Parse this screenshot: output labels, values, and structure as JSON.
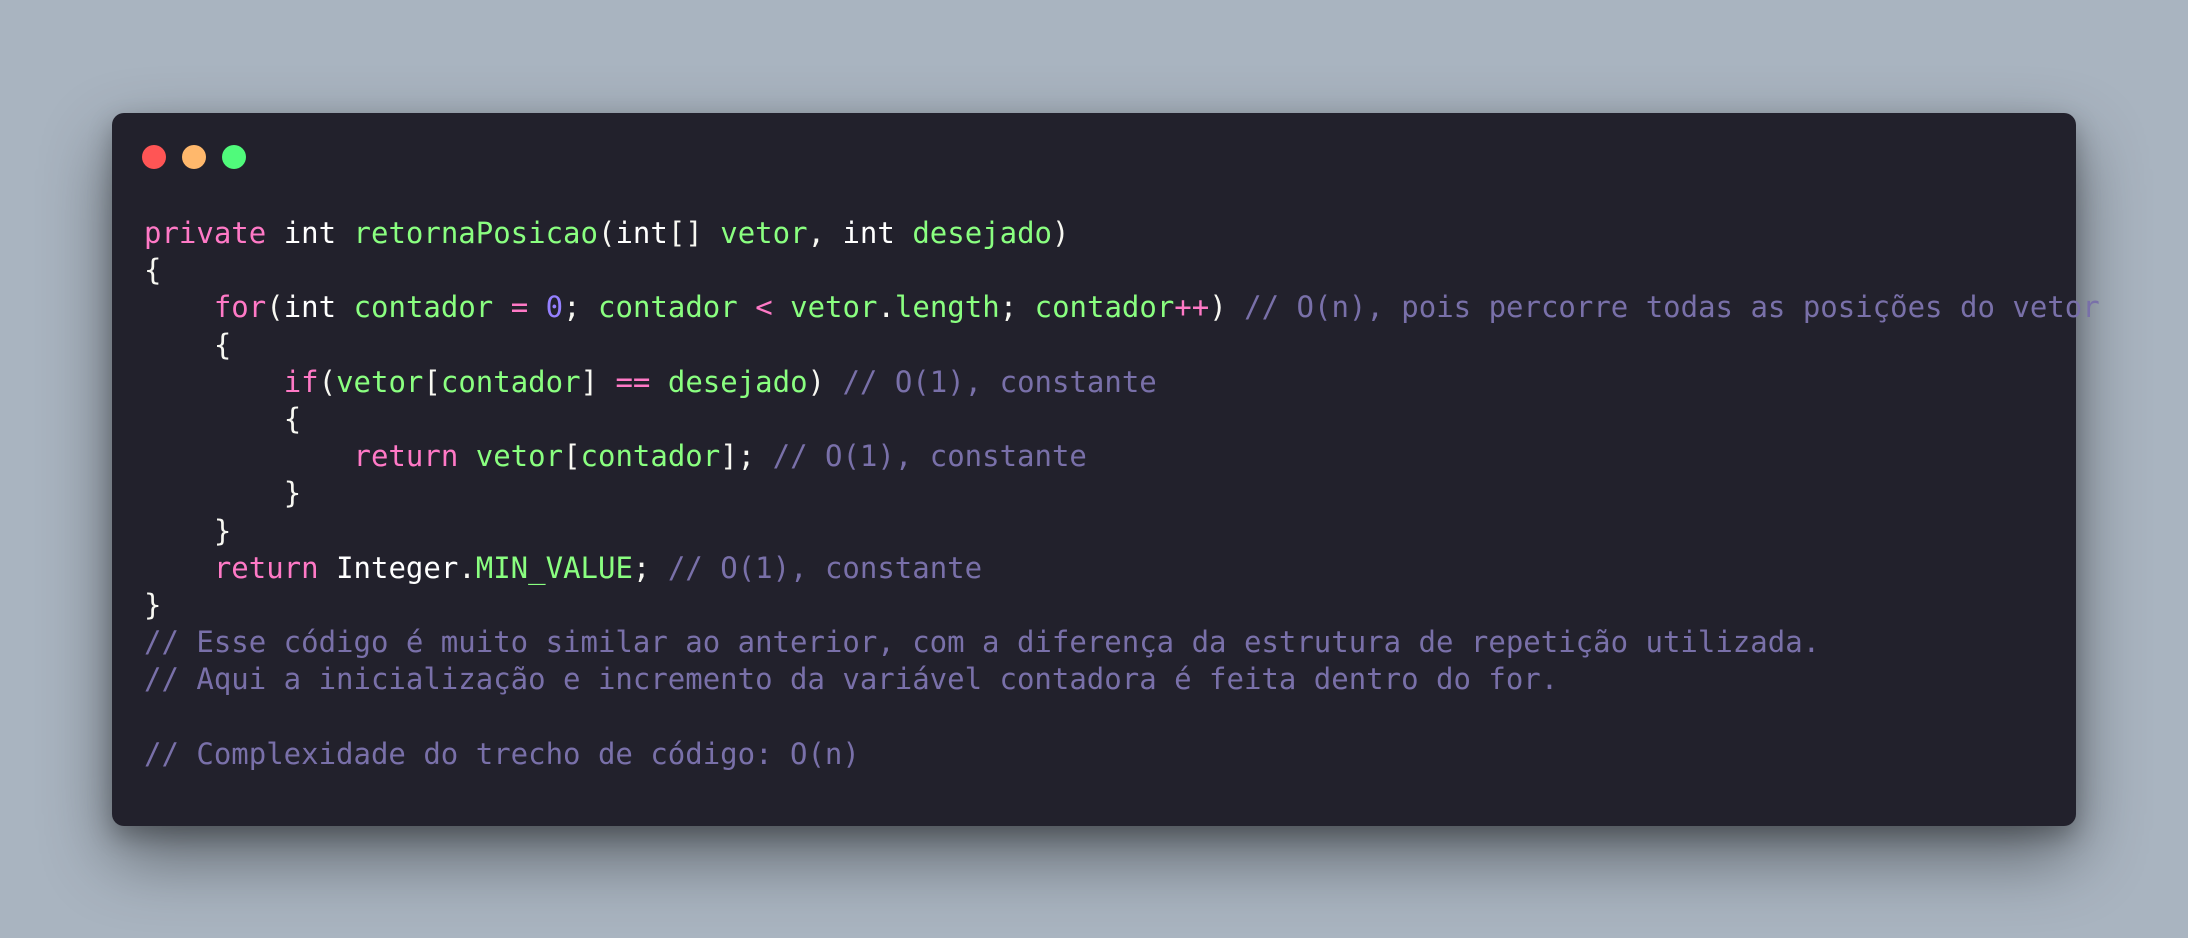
{
  "window": {
    "controls": [
      {
        "name": "close-button",
        "color": "#ff5555"
      },
      {
        "name": "minimize-button",
        "color": "#ffb86c"
      },
      {
        "name": "maximize-button",
        "color": "#50fa7b"
      }
    ]
  },
  "code_lines": [
    [
      {
        "t": "private",
        "k": "kw"
      },
      {
        "t": " ",
        "k": "plain"
      },
      {
        "t": "int",
        "k": "type"
      },
      {
        "t": " ",
        "k": "plain"
      },
      {
        "t": "retornaPosicao",
        "k": "fn"
      },
      {
        "t": "(",
        "k": "punct"
      },
      {
        "t": "int",
        "k": "type"
      },
      {
        "t": "[] ",
        "k": "punct"
      },
      {
        "t": "vetor",
        "k": "var"
      },
      {
        "t": ", ",
        "k": "punct"
      },
      {
        "t": "int",
        "k": "type"
      },
      {
        "t": " ",
        "k": "plain"
      },
      {
        "t": "desejado",
        "k": "var"
      },
      {
        "t": ")",
        "k": "punct"
      }
    ],
    [
      {
        "t": "{",
        "k": "punct"
      }
    ],
    [
      {
        "t": "    ",
        "k": "plain"
      },
      {
        "t": "for",
        "k": "kw"
      },
      {
        "t": "(",
        "k": "punct"
      },
      {
        "t": "int",
        "k": "type"
      },
      {
        "t": " ",
        "k": "plain"
      },
      {
        "t": "contador",
        "k": "var"
      },
      {
        "t": " ",
        "k": "plain"
      },
      {
        "t": "=",
        "k": "op"
      },
      {
        "t": " ",
        "k": "plain"
      },
      {
        "t": "0",
        "k": "num"
      },
      {
        "t": "; ",
        "k": "punct"
      },
      {
        "t": "contador",
        "k": "var"
      },
      {
        "t": " ",
        "k": "plain"
      },
      {
        "t": "<",
        "k": "op"
      },
      {
        "t": " ",
        "k": "plain"
      },
      {
        "t": "vetor",
        "k": "var"
      },
      {
        "t": ".",
        "k": "punct"
      },
      {
        "t": "length",
        "k": "var"
      },
      {
        "t": "; ",
        "k": "punct"
      },
      {
        "t": "contador",
        "k": "var"
      },
      {
        "t": "++",
        "k": "op"
      },
      {
        "t": ") ",
        "k": "punct"
      },
      {
        "t": "// O(n), pois percorre todas as posições do vetor",
        "k": "cmt"
      }
    ],
    [
      {
        "t": "    ",
        "k": "plain"
      },
      {
        "t": "{",
        "k": "punct"
      }
    ],
    [
      {
        "t": "        ",
        "k": "plain"
      },
      {
        "t": "if",
        "k": "kw"
      },
      {
        "t": "(",
        "k": "punct"
      },
      {
        "t": "vetor",
        "k": "var"
      },
      {
        "t": "[",
        "k": "punct"
      },
      {
        "t": "contador",
        "k": "var"
      },
      {
        "t": "] ",
        "k": "punct"
      },
      {
        "t": "==",
        "k": "op"
      },
      {
        "t": " ",
        "k": "plain"
      },
      {
        "t": "desejado",
        "k": "var"
      },
      {
        "t": ") ",
        "k": "punct"
      },
      {
        "t": "// O(1), constante",
        "k": "cmt"
      }
    ],
    [
      {
        "t": "        ",
        "k": "plain"
      },
      {
        "t": "{",
        "k": "punct"
      }
    ],
    [
      {
        "t": "            ",
        "k": "plain"
      },
      {
        "t": "return",
        "k": "kw"
      },
      {
        "t": " ",
        "k": "plain"
      },
      {
        "t": "vetor",
        "k": "var"
      },
      {
        "t": "[",
        "k": "punct"
      },
      {
        "t": "contador",
        "k": "var"
      },
      {
        "t": "]; ",
        "k": "punct"
      },
      {
        "t": "// O(1), constante",
        "k": "cmt"
      }
    ],
    [
      {
        "t": "        ",
        "k": "plain"
      },
      {
        "t": "}",
        "k": "punct"
      }
    ],
    [
      {
        "t": "    ",
        "k": "plain"
      },
      {
        "t": "}",
        "k": "punct"
      }
    ],
    [
      {
        "t": "    ",
        "k": "plain"
      },
      {
        "t": "return",
        "k": "kw"
      },
      {
        "t": " ",
        "k": "plain"
      },
      {
        "t": "Integer",
        "k": "type"
      },
      {
        "t": ".",
        "k": "punct"
      },
      {
        "t": "MIN_VALUE",
        "k": "const"
      },
      {
        "t": "; ",
        "k": "punct"
      },
      {
        "t": "// O(1), constante",
        "k": "cmt"
      }
    ],
    [
      {
        "t": "}",
        "k": "punct"
      }
    ],
    [
      {
        "t": "// Esse código é muito similar ao anterior, com a diferença da estrutura de repetição utilizada.",
        "k": "cmt"
      }
    ],
    [
      {
        "t": "// Aqui a inicialização e incremento da variável contadora é feita dentro do for.",
        "k": "cmt"
      }
    ],
    [],
    [
      {
        "t": "// Complexidade do trecho de código: O(n)",
        "k": "cmt"
      }
    ]
  ]
}
